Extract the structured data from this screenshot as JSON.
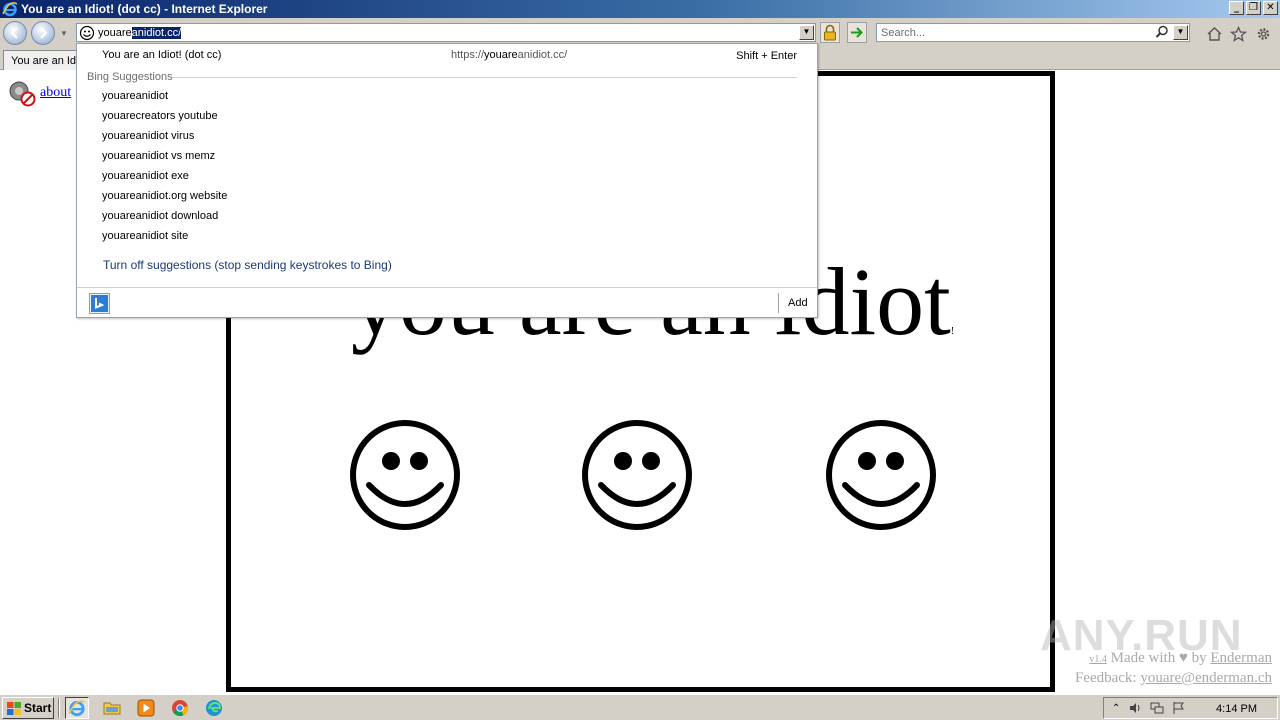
{
  "window": {
    "title": "You are an Idiot! (dot cc) - Internet Explorer",
    "buttons": {
      "minimize": "_",
      "restore": "❐",
      "close": "✕"
    }
  },
  "address_bar": {
    "typed": "youare",
    "autocomplete": "anidiot.cc/"
  },
  "search": {
    "placeholder": "Search..."
  },
  "tab": {
    "label": "You are an Idiot! (dot cc)"
  },
  "suggestions": {
    "top_result_title": "You are an Idiot! (dot cc)",
    "top_result_url_prefix": "https://",
    "top_result_url_match": "youare",
    "top_result_url_rest": "anidiot.cc/",
    "shortcut": "Shift + Enter",
    "heading": "Bing Suggestions",
    "items": [
      "youareanidiot",
      "youarecreators youtube",
      "youareanidiot virus",
      "youareanidiot vs memz",
      "youareanidiot exe",
      "youareanidiot.org website",
      "youareanidiot download",
      "youareanidiot site"
    ],
    "turn_off": "Turn off suggestions (stop sending keystrokes to Bing)",
    "add": "Add"
  },
  "page": {
    "about_link": "about",
    "headline": "you are an idiot",
    "exclaim": "!",
    "version": "v1.4",
    "made_with": "Made with",
    "by": "by",
    "author": "Enderman",
    "feedback_label": "Feedback:",
    "feedback_email": "youare@enderman.ch",
    "watermark": "ANY.RUN"
  },
  "taskbar": {
    "start": "Start",
    "clock": "4:14 PM"
  },
  "colors": {
    "titlebar": "#0a246a",
    "selection": "#0a246a",
    "link": "#0000ee",
    "chrome": "#d4d0c8"
  },
  "icons": [
    "ie-logo-icon",
    "back-icon",
    "forward-icon",
    "smiley-favicon-icon",
    "lock-icon",
    "go-arrow-icon",
    "search-icon",
    "home-icon",
    "favorites-star-icon",
    "gear-icon",
    "blocked-audio-icon",
    "bing-icon",
    "windows-flag-icon",
    "explorer-folder-icon",
    "media-player-icon",
    "chrome-icon",
    "edge-icon",
    "speaker-icon",
    "network-icon",
    "action-center-flag-icon"
  ]
}
